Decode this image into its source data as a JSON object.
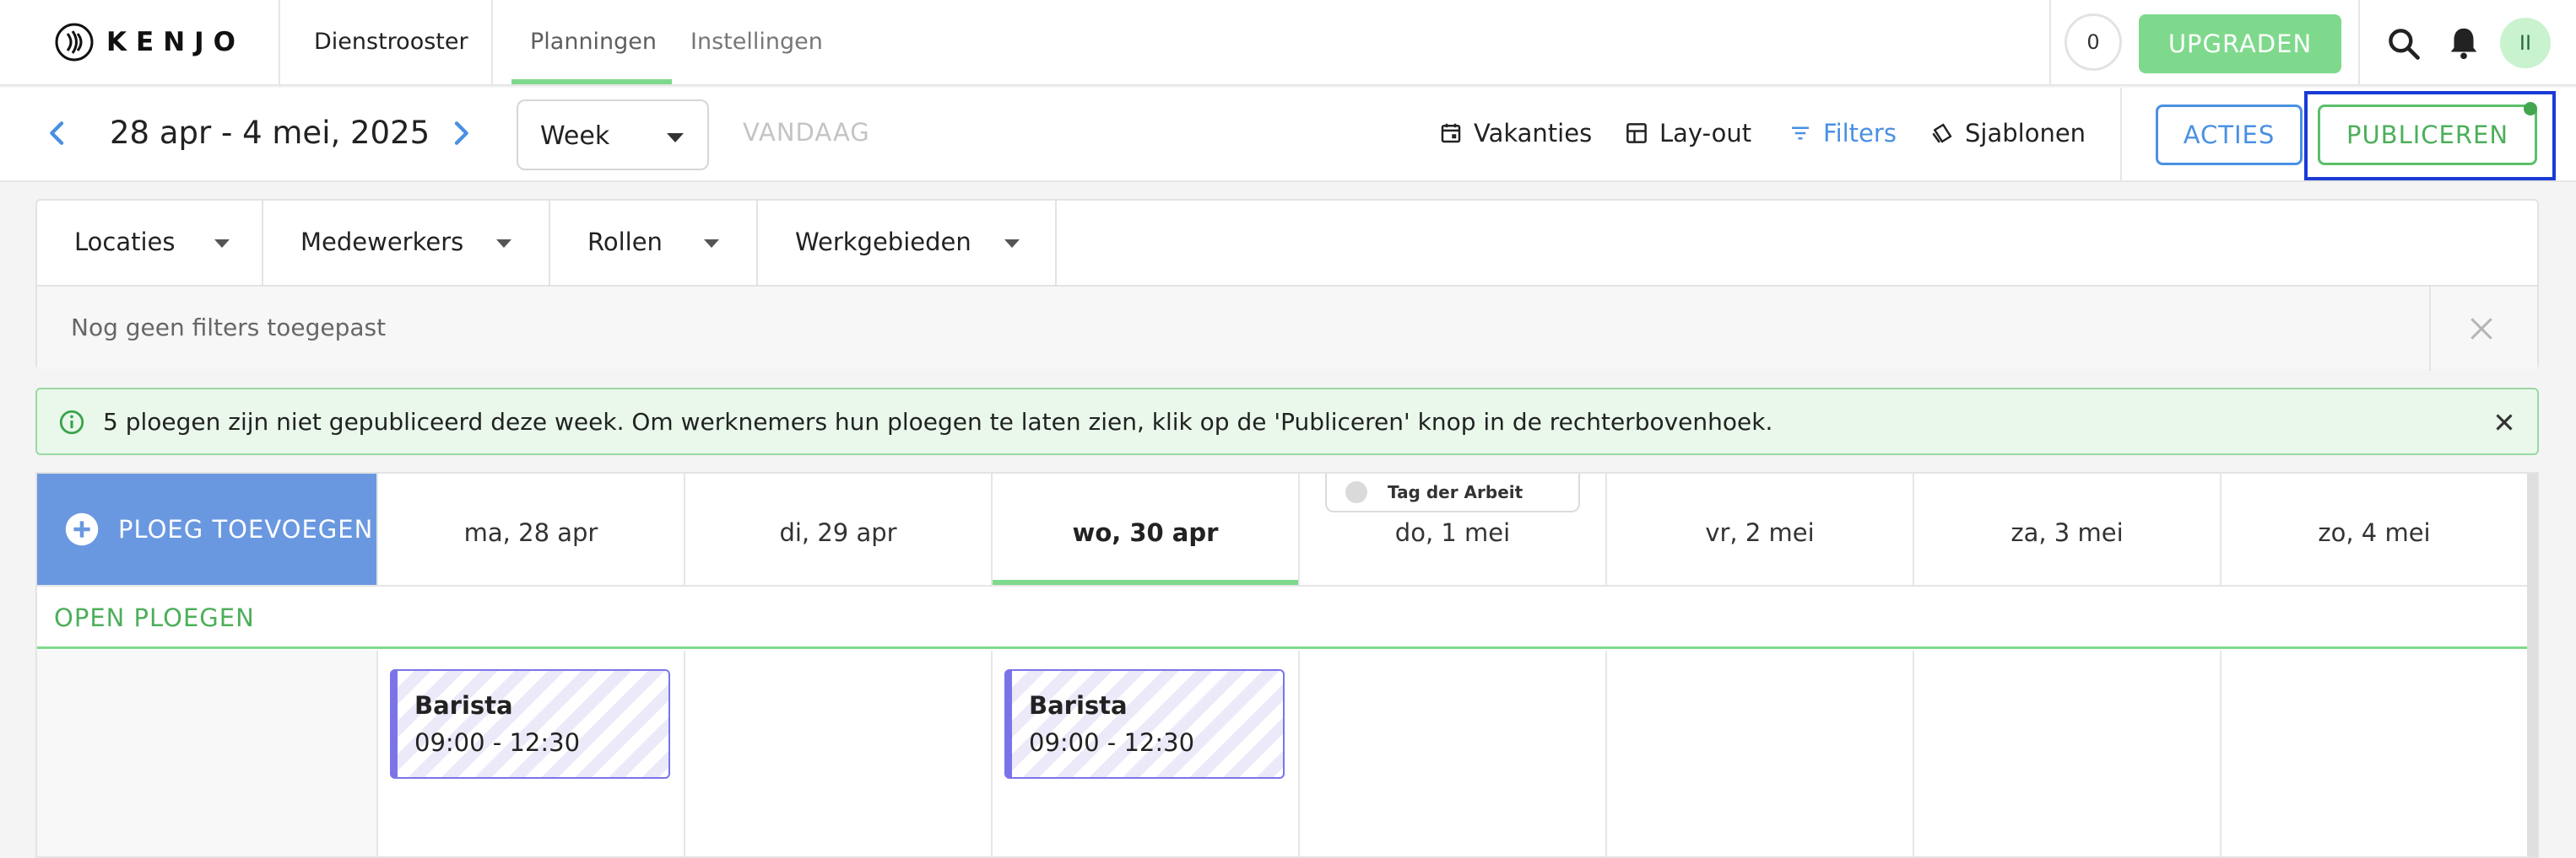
{
  "brand": {
    "name": "KENJO"
  },
  "nav": {
    "dienstrooster": "Dienstrooster",
    "tabs": [
      {
        "label": "Planningen",
        "active": true
      },
      {
        "label": "Instellingen",
        "active": false
      }
    ],
    "counter": "0",
    "upgrade_label": "UPGRADEN",
    "avatar_initials": "II"
  },
  "toolbar": {
    "date_range": "28 apr - 4 mei, 2025",
    "view_select": "Week",
    "today_label": "VANDAAG",
    "vacations_label": "Vakanties",
    "layout_label": "Lay-out",
    "filters_label": "Filters",
    "templates_label": "Sjablonen",
    "actions_label": "ACTIES",
    "publish_label": "PUBLICEREN"
  },
  "filters": {
    "dropdowns": [
      "Locaties",
      "Medewerkers",
      "Rollen",
      "Werkgebieden"
    ],
    "empty_text": "Nog geen filters toegepast"
  },
  "notice": {
    "text": "5 ploegen zijn niet gepubliceerd deze week. Om werknemers hun ploegen te laten zien, klik op de 'Publiceren' knop in de rechterbovenhoek."
  },
  "schedule": {
    "add_shift_label": "PLOEG TOEVOEGEN",
    "days": [
      "ma, 28 apr",
      "di, 29 apr",
      "wo, 30 apr",
      "do, 1 mei",
      "vr, 2 mei",
      "za, 3 mei",
      "zo, 4 mei"
    ],
    "today": "wo, 30 apr",
    "holiday_label": "Tag der Arbeit",
    "open_shifts_label": "OPEN PLOEGEN",
    "shifts": [
      {
        "day": "ma, 28 apr",
        "role": "Barista",
        "time": "09:00 - 12:30"
      },
      {
        "day": "wo, 30 apr",
        "role": "Barista",
        "time": "09:00 - 12:30"
      }
    ]
  },
  "colors": {
    "accent_green": "#7ed98c",
    "accent_blue": "#4a90e2",
    "shift_purple": "#7a74e8",
    "add_shift_blue": "#6a98e0",
    "focus_outline": "#1a3bd6"
  }
}
